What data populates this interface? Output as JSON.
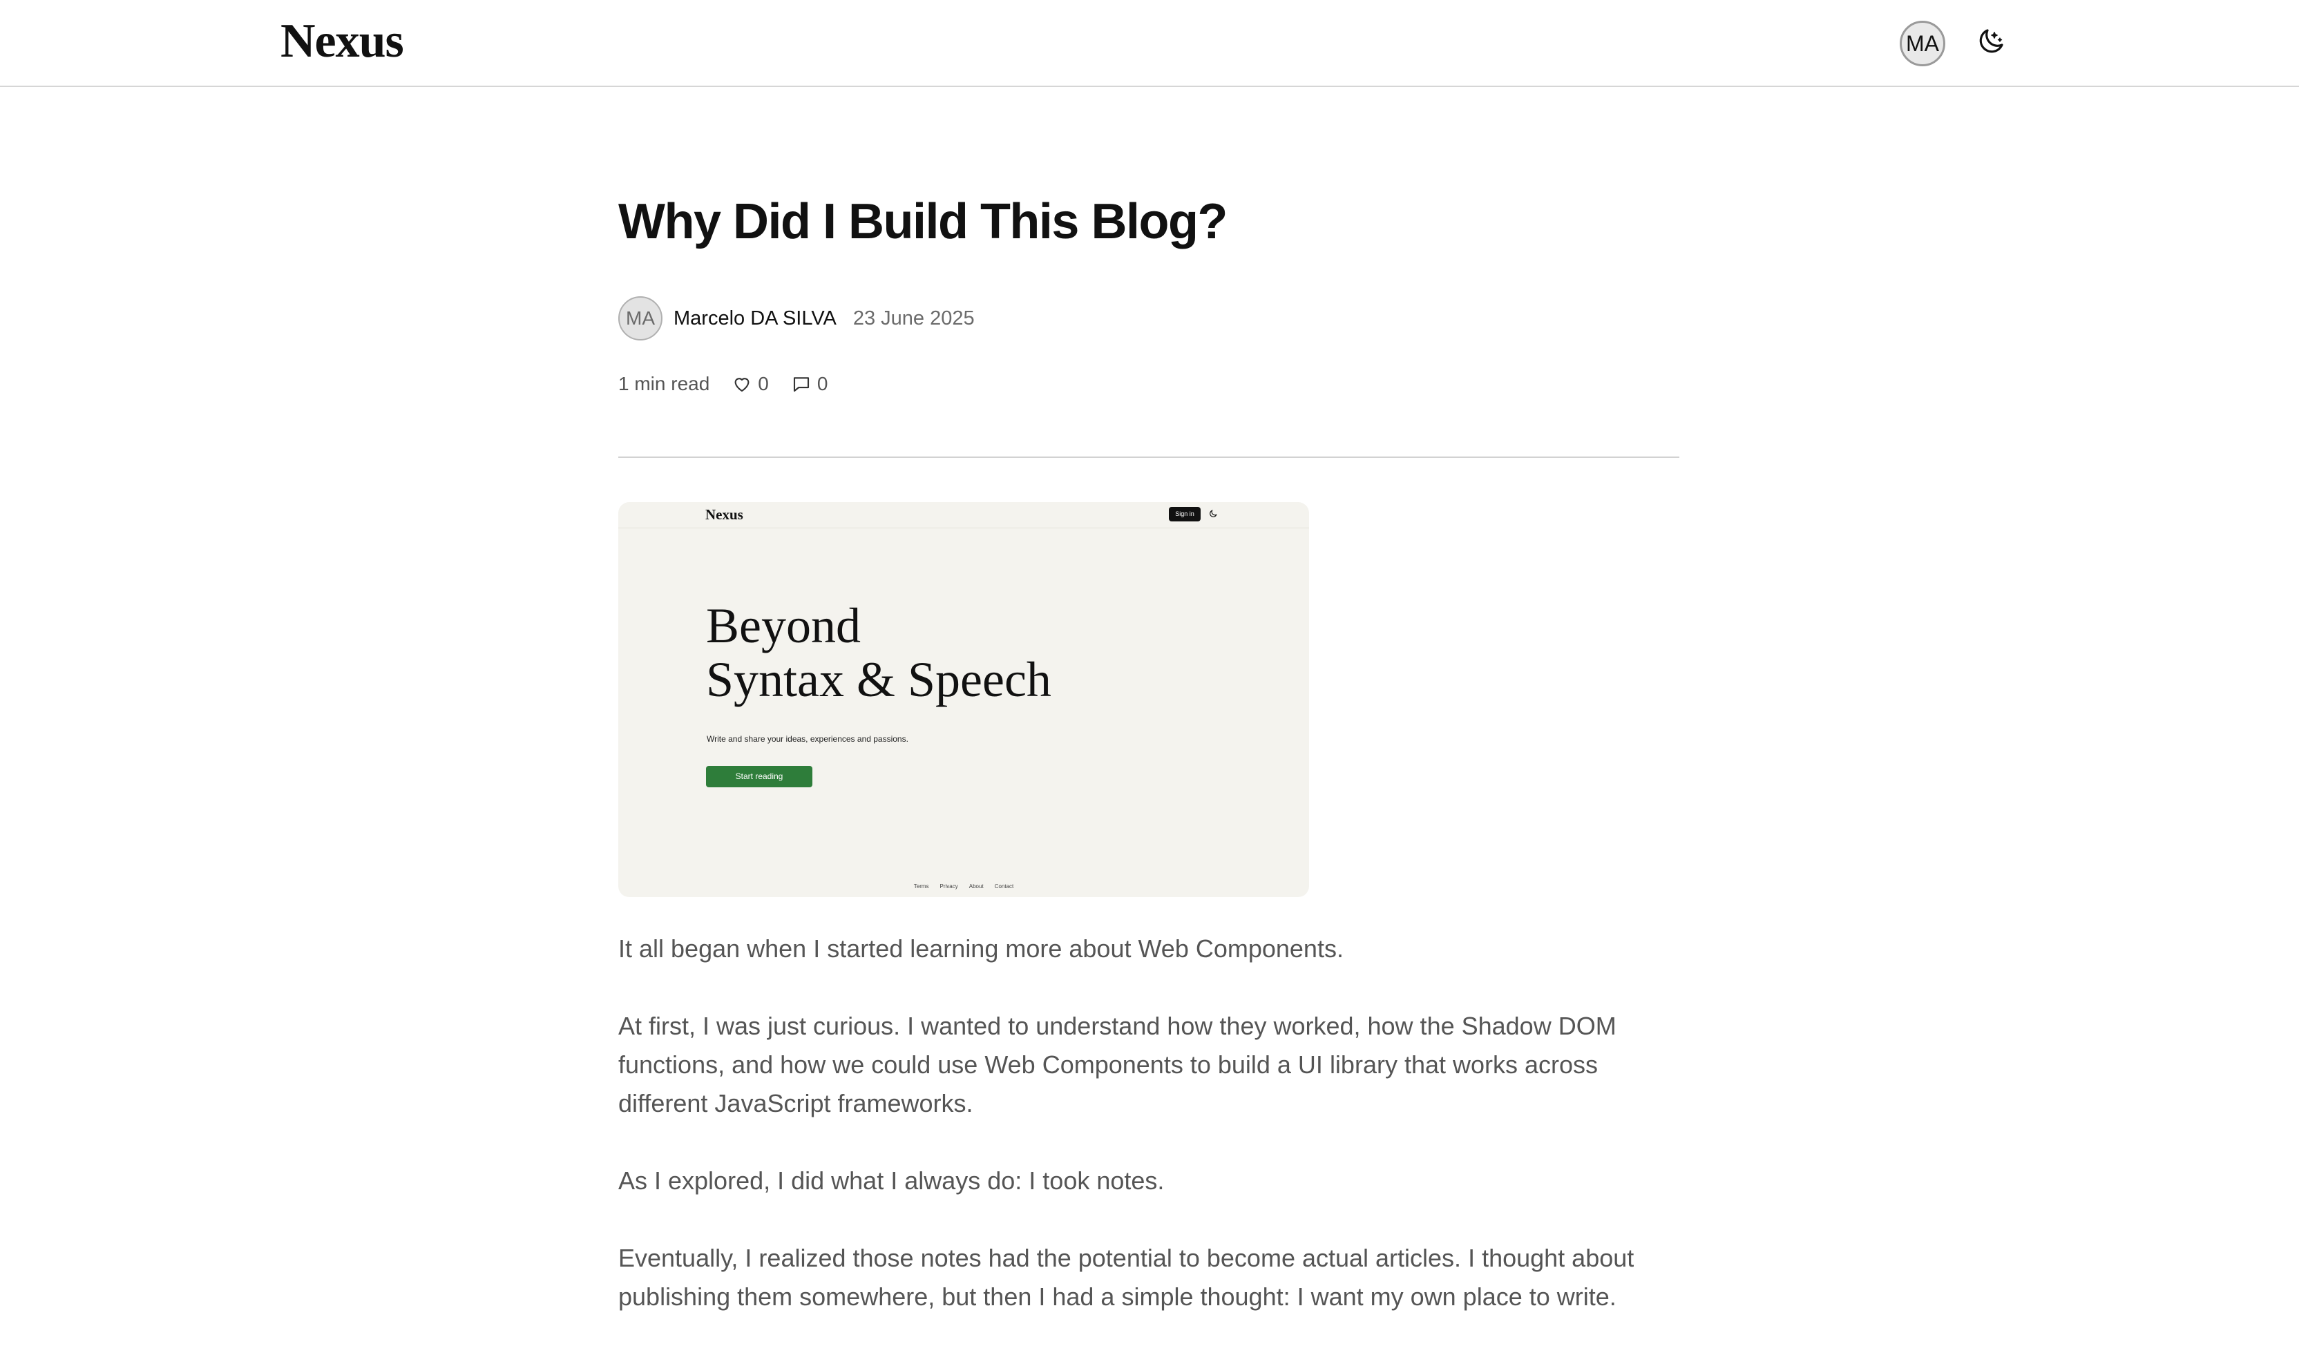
{
  "header": {
    "logo": "Nexus",
    "user_initials": "MA",
    "theme_toggle_icon": "moon-stars-icon"
  },
  "article": {
    "title": "Why Did I Build This Blog?",
    "author": {
      "initials": "MA",
      "name": "Marcelo DA SILVA"
    },
    "date": "23 June 2025",
    "read_time": "1 min read",
    "likes": "0",
    "comments": "0",
    "like_icon": "heart-icon",
    "comment_icon": "comment-icon",
    "hero_image": {
      "logo": "Nexus",
      "signin_label": "Sign in",
      "headline_line1": "Beyond",
      "headline_line2": "Syntax & Speech",
      "subtitle": "Write and share your ideas, experiences and passions.",
      "cta_label": "Start reading",
      "footer_links": [
        "Terms",
        "Privacy",
        "About",
        "Contact"
      ]
    },
    "paragraphs": [
      "It all began when I started learning more about Web Components.",
      "At first, I was just curious. I wanted to understand how they worked, how the Shadow DOM functions, and how we could use Web Components to build a UI library that works across different JavaScript frameworks.",
      "As I explored, I did what I always do: I took notes.",
      "Eventually, I realized those notes had the potential to become actual articles. I thought about publishing them somewhere, but then I had a simple thought: I want my own place to write."
    ]
  },
  "colors": {
    "background": "#ffffff",
    "text_primary": "#111111",
    "text_body": "#555555",
    "hero_bg": "#f4f3ee",
    "cta_green": "#2e7d3a"
  }
}
